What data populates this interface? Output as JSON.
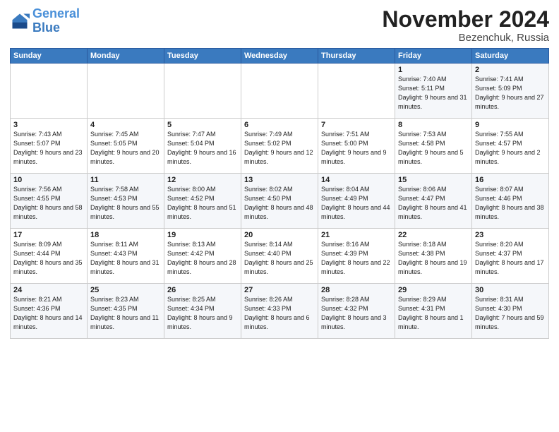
{
  "header": {
    "logo_general": "General",
    "logo_blue": "Blue",
    "month_title": "November 2024",
    "subtitle": "Bezenchuk, Russia"
  },
  "days_of_week": [
    "Sunday",
    "Monday",
    "Tuesday",
    "Wednesday",
    "Thursday",
    "Friday",
    "Saturday"
  ],
  "weeks": [
    [
      {
        "day": "",
        "info": ""
      },
      {
        "day": "",
        "info": ""
      },
      {
        "day": "",
        "info": ""
      },
      {
        "day": "",
        "info": ""
      },
      {
        "day": "",
        "info": ""
      },
      {
        "day": "1",
        "info": "Sunrise: 7:40 AM\nSunset: 5:11 PM\nDaylight: 9 hours and 31 minutes."
      },
      {
        "day": "2",
        "info": "Sunrise: 7:41 AM\nSunset: 5:09 PM\nDaylight: 9 hours and 27 minutes."
      }
    ],
    [
      {
        "day": "3",
        "info": "Sunrise: 7:43 AM\nSunset: 5:07 PM\nDaylight: 9 hours and 23 minutes."
      },
      {
        "day": "4",
        "info": "Sunrise: 7:45 AM\nSunset: 5:05 PM\nDaylight: 9 hours and 20 minutes."
      },
      {
        "day": "5",
        "info": "Sunrise: 7:47 AM\nSunset: 5:04 PM\nDaylight: 9 hours and 16 minutes."
      },
      {
        "day": "6",
        "info": "Sunrise: 7:49 AM\nSunset: 5:02 PM\nDaylight: 9 hours and 12 minutes."
      },
      {
        "day": "7",
        "info": "Sunrise: 7:51 AM\nSunset: 5:00 PM\nDaylight: 9 hours and 9 minutes."
      },
      {
        "day": "8",
        "info": "Sunrise: 7:53 AM\nSunset: 4:58 PM\nDaylight: 9 hours and 5 minutes."
      },
      {
        "day": "9",
        "info": "Sunrise: 7:55 AM\nSunset: 4:57 PM\nDaylight: 9 hours and 2 minutes."
      }
    ],
    [
      {
        "day": "10",
        "info": "Sunrise: 7:56 AM\nSunset: 4:55 PM\nDaylight: 8 hours and 58 minutes."
      },
      {
        "day": "11",
        "info": "Sunrise: 7:58 AM\nSunset: 4:53 PM\nDaylight: 8 hours and 55 minutes."
      },
      {
        "day": "12",
        "info": "Sunrise: 8:00 AM\nSunset: 4:52 PM\nDaylight: 8 hours and 51 minutes."
      },
      {
        "day": "13",
        "info": "Sunrise: 8:02 AM\nSunset: 4:50 PM\nDaylight: 8 hours and 48 minutes."
      },
      {
        "day": "14",
        "info": "Sunrise: 8:04 AM\nSunset: 4:49 PM\nDaylight: 8 hours and 44 minutes."
      },
      {
        "day": "15",
        "info": "Sunrise: 8:06 AM\nSunset: 4:47 PM\nDaylight: 8 hours and 41 minutes."
      },
      {
        "day": "16",
        "info": "Sunrise: 8:07 AM\nSunset: 4:46 PM\nDaylight: 8 hours and 38 minutes."
      }
    ],
    [
      {
        "day": "17",
        "info": "Sunrise: 8:09 AM\nSunset: 4:44 PM\nDaylight: 8 hours and 35 minutes."
      },
      {
        "day": "18",
        "info": "Sunrise: 8:11 AM\nSunset: 4:43 PM\nDaylight: 8 hours and 31 minutes."
      },
      {
        "day": "19",
        "info": "Sunrise: 8:13 AM\nSunset: 4:42 PM\nDaylight: 8 hours and 28 minutes."
      },
      {
        "day": "20",
        "info": "Sunrise: 8:14 AM\nSunset: 4:40 PM\nDaylight: 8 hours and 25 minutes."
      },
      {
        "day": "21",
        "info": "Sunrise: 8:16 AM\nSunset: 4:39 PM\nDaylight: 8 hours and 22 minutes."
      },
      {
        "day": "22",
        "info": "Sunrise: 8:18 AM\nSunset: 4:38 PM\nDaylight: 8 hours and 19 minutes."
      },
      {
        "day": "23",
        "info": "Sunrise: 8:20 AM\nSunset: 4:37 PM\nDaylight: 8 hours and 17 minutes."
      }
    ],
    [
      {
        "day": "24",
        "info": "Sunrise: 8:21 AM\nSunset: 4:36 PM\nDaylight: 8 hours and 14 minutes."
      },
      {
        "day": "25",
        "info": "Sunrise: 8:23 AM\nSunset: 4:35 PM\nDaylight: 8 hours and 11 minutes."
      },
      {
        "day": "26",
        "info": "Sunrise: 8:25 AM\nSunset: 4:34 PM\nDaylight: 8 hours and 9 minutes."
      },
      {
        "day": "27",
        "info": "Sunrise: 8:26 AM\nSunset: 4:33 PM\nDaylight: 8 hours and 6 minutes."
      },
      {
        "day": "28",
        "info": "Sunrise: 8:28 AM\nSunset: 4:32 PM\nDaylight: 8 hours and 3 minutes."
      },
      {
        "day": "29",
        "info": "Sunrise: 8:29 AM\nSunset: 4:31 PM\nDaylight: 8 hours and 1 minute."
      },
      {
        "day": "30",
        "info": "Sunrise: 8:31 AM\nSunset: 4:30 PM\nDaylight: 7 hours and 59 minutes."
      }
    ]
  ]
}
